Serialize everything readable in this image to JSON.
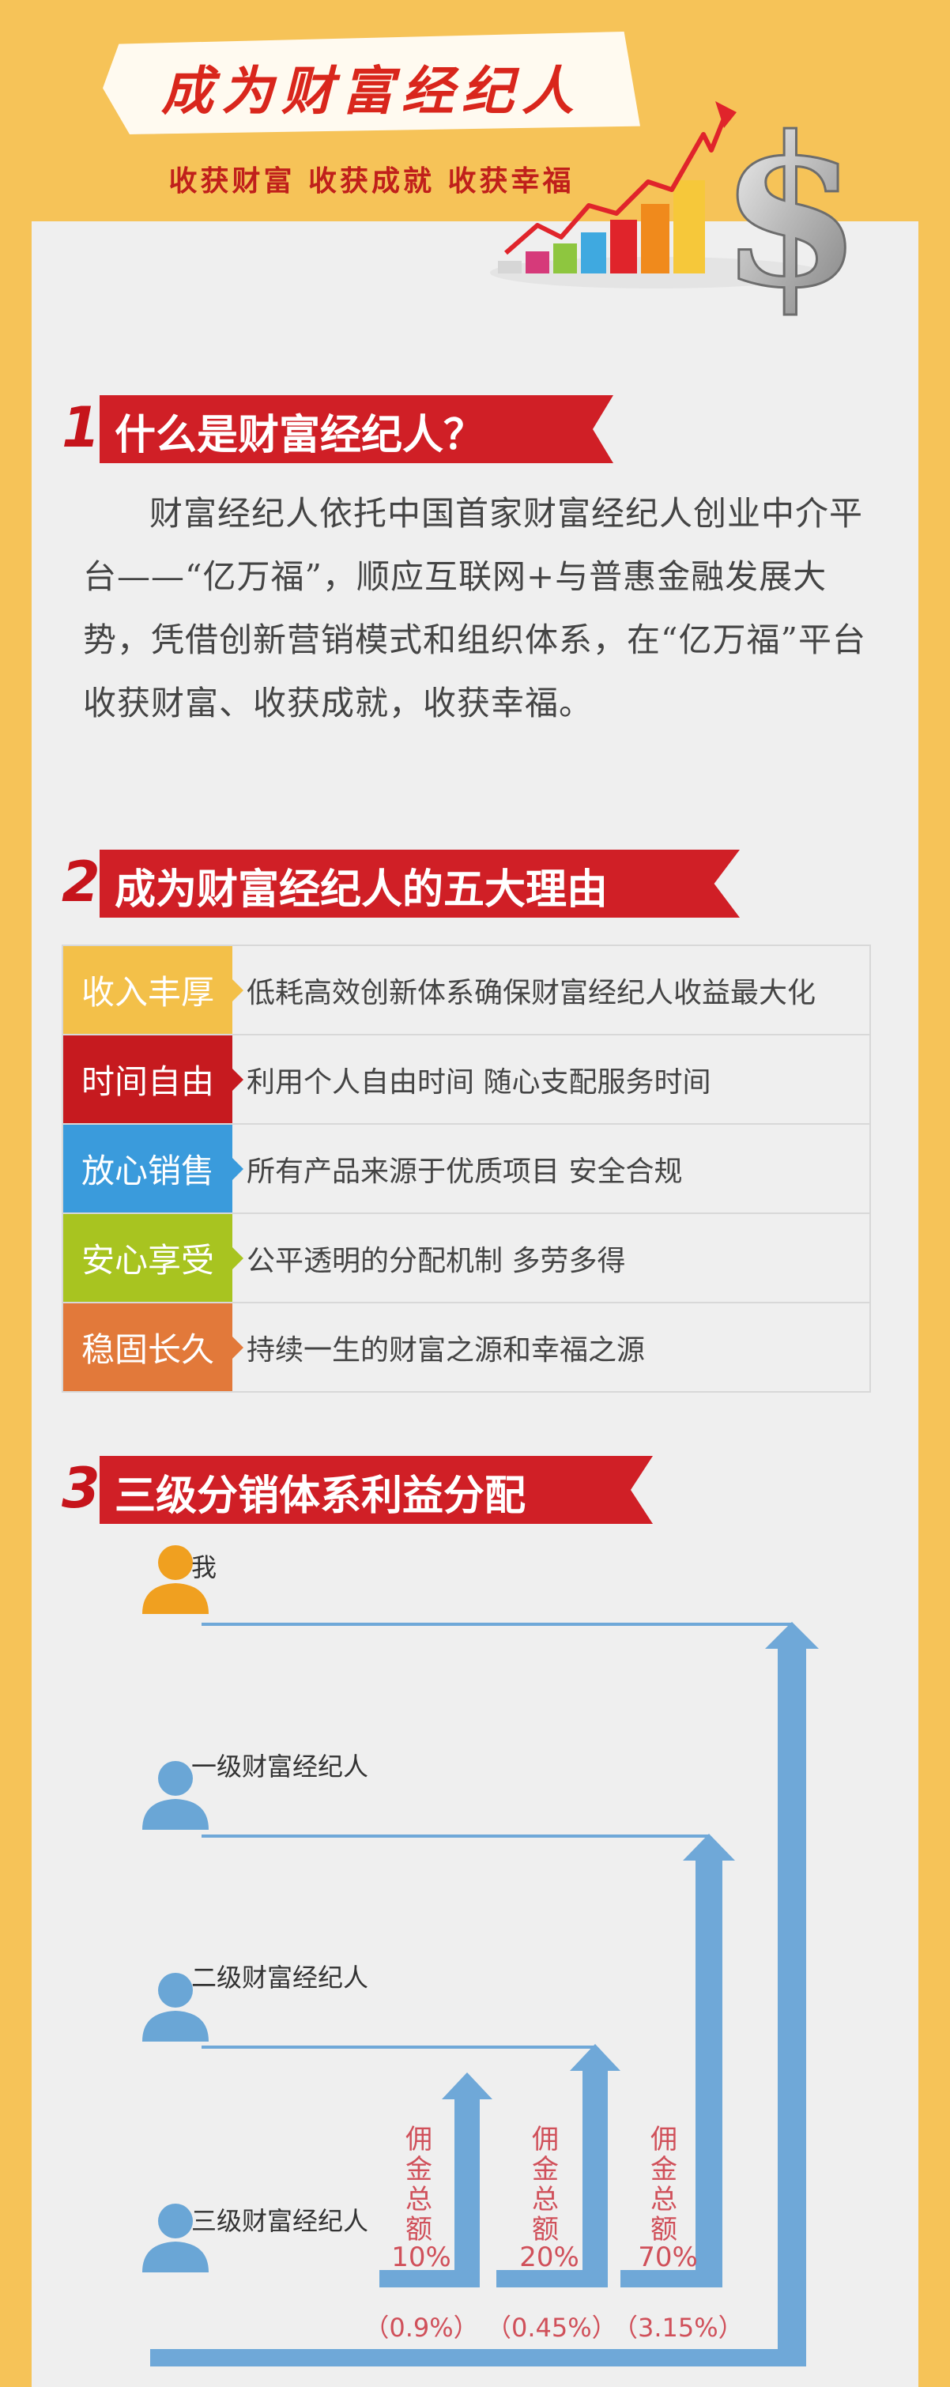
{
  "header": {
    "title": "成为财富经纪人",
    "subtitle": "收获财富 收获成就 收获幸福"
  },
  "sections": [
    {
      "number": "1",
      "title": "什么是财富经纪人？"
    },
    {
      "number": "2",
      "title": "成为财富经纪人的五大理由"
    },
    {
      "number": "3",
      "title": "三级分销体系利益分配"
    }
  ],
  "intro": "财富经纪人依托中国首家财富经纪人创业中介平台——“亿万福”，顺应互联网+与普惠金融发展大势，凭借创新营销模式和组织体系，在“亿万福”平台收获财富、收获成就，收获幸福。",
  "reasons": [
    {
      "tag": "收入丰厚",
      "text": "低耗高效创新体系确保财富经纪人收益最大化",
      "color": "#f3c049"
    },
    {
      "tag": "时间自由",
      "text": "利用个人自由时间  随心支配服务时间",
      "color": "#c61a1f"
    },
    {
      "tag": "放心销售",
      "text": "所有产品来源于优质项目  安全合规",
      "color": "#3a9bdc"
    },
    {
      "tag": "安心享受",
      "text": "公平透明的分配机制  多劳多得",
      "color": "#a8c420"
    },
    {
      "tag": "稳固长久",
      "text": "持续一生的财富之源和幸福之源",
      "color": "#e2793a"
    }
  ],
  "distribution": {
    "levels": [
      "我",
      "一级财富经纪人",
      "二级财富经纪人",
      "三级财富经纪人"
    ],
    "commission_label": "佣金总额",
    "commissions": [
      {
        "percent": "10%",
        "share": "（0.9%）"
      },
      {
        "percent": "20%",
        "share": "（0.45%）"
      },
      {
        "percent": "70%",
        "share": "（3.15%）"
      }
    ]
  },
  "colors": {
    "background": "#f6c358",
    "accent_red": "#d01f26",
    "arrow_blue": "#6fa8d8",
    "person_orange": "#f0a020",
    "person_blue": "#6aa6d6"
  }
}
